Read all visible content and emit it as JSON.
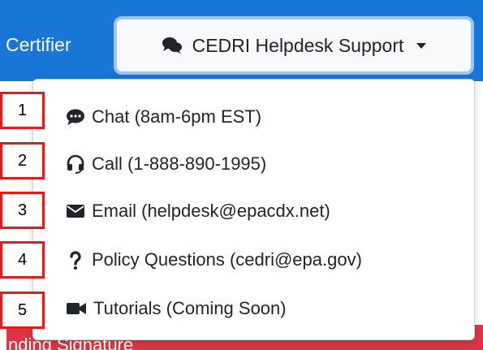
{
  "navbar": {
    "link_label": "Certifier",
    "background": "#1877d6"
  },
  "helpdesk_button": {
    "icon": "comments-icon",
    "label": "CEDRI Helpdesk Support"
  },
  "menu": {
    "items": [
      {
        "icon": "chat-icon",
        "label": "Chat (8am-6pm EST)"
      },
      {
        "icon": "headset-icon",
        "label": "Call (1-888-890-1995)"
      },
      {
        "icon": "envelope-icon",
        "label": "Email (helpdesk@epacdx.net)"
      },
      {
        "icon": "question-icon",
        "label": "Policy Questions (cedri@epa.gov)"
      },
      {
        "icon": "video-icon",
        "label": "Tutorials (Coming Soon)"
      }
    ]
  },
  "annotations": [
    "1",
    "2",
    "3",
    "4",
    "5"
  ],
  "background_content": {
    "red_bar_text": "nding Signature",
    "red_bar_color": "#dc3545"
  }
}
